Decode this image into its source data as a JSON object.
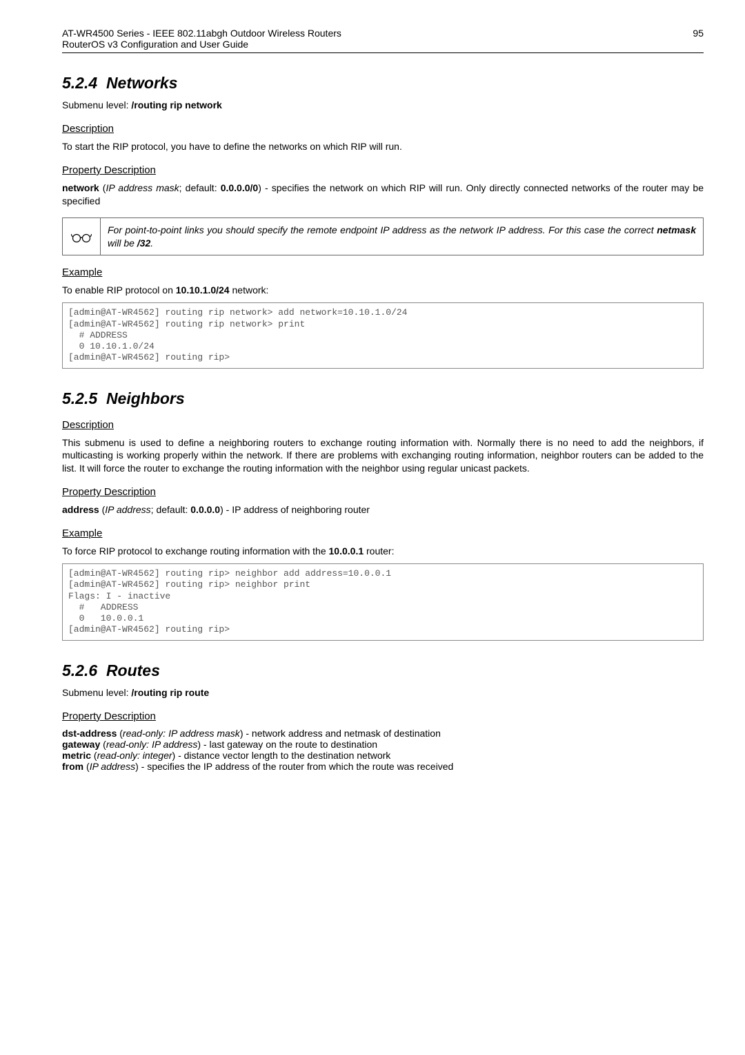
{
  "header": {
    "title_line1": "AT-WR4500 Series - IEEE 802.11abgh Outdoor Wireless Routers",
    "title_line2": "RouterOS v3 Configuration and User Guide",
    "page_no": "95"
  },
  "s524": {
    "num": "5.2.4",
    "name": "Networks",
    "submenu_label": "Submenu level: ",
    "submenu_value": "/routing rip network",
    "desc_title": "Description",
    "desc_text": "To start the RIP protocol, you have to define the networks on which RIP will run.",
    "prop_title": "Property Description",
    "prop_strong": "network",
    "prop_rest": " (",
    "prop_em": "IP address mask",
    "prop_rest2": "; default: ",
    "prop_def": "0.0.0.0/0",
    "prop_rest3": ") - specifies the network on which RIP will run. Only directly connected networks of the router may be specified",
    "note1": "For point-to-point links you should specify the remote endpoint IP address as the network IP address. For this case the correct ",
    "note_strong": "netmask",
    "note2": " will be ",
    "note_val": "/32",
    "note3": ".",
    "ex_title": "Example",
    "ex_intro1": "To enable RIP protocol on ",
    "ex_intro_val": "10.10.1.0/24",
    "ex_intro2": " network:",
    "code": "[admin@AT-WR4562] routing rip network> add network=10.10.1.0/24\n[admin@AT-WR4562] routing rip network> print\n  # ADDRESS\n  0 10.10.1.0/24\n[admin@AT-WR4562] routing rip>"
  },
  "s525": {
    "num": "5.2.5",
    "name": "Neighbors",
    "desc_title": "Description",
    "desc_text": "This submenu is used to define a neighboring routers to exchange routing information with. Normally there is no need to add the neighbors, if multicasting is working properly within the network. If there are problems with exchanging routing information, neighbor routers can be added to the list. It will force the router to exchange the routing information with the neighbor using regular unicast packets.",
    "prop_title": "Property Description",
    "prop_strong": "address",
    "prop_rest": " (",
    "prop_em": "IP address",
    "prop_rest2": "; default: ",
    "prop_def": "0.0.0.0",
    "prop_rest3": ") - IP address of neighboring router",
    "ex_title": "Example",
    "ex_intro1": "To force RIP protocol to exchange routing information with the ",
    "ex_intro_val": "10.0.0.1",
    "ex_intro2": " router:",
    "code": "[admin@AT-WR4562] routing rip> neighbor add address=10.0.0.1\n[admin@AT-WR4562] routing rip> neighbor print\nFlags: I - inactive\n  #   ADDRESS\n  0   10.0.0.1\n[admin@AT-WR4562] routing rip>"
  },
  "s526": {
    "num": "5.2.6",
    "name": "Routes",
    "submenu_label": "Submenu level: ",
    "submenu_value": "/routing rip route",
    "prop_title": "Property Description",
    "p1s": "dst-address",
    "p1e": "read-only: IP address mask",
    "p1d": ") - network address and netmask of destination",
    "p2s": "gateway",
    "p2e": "read-only: IP address",
    "p2d": ") - last gateway on the route to destination",
    "p3s": "metric",
    "p3e": "read-only: integer",
    "p3d": ") - distance vector length to the destination network",
    "p4s": "from",
    "p4e": "IP address",
    "p4d": ") - specifies the IP address of the router from which the route was received"
  }
}
